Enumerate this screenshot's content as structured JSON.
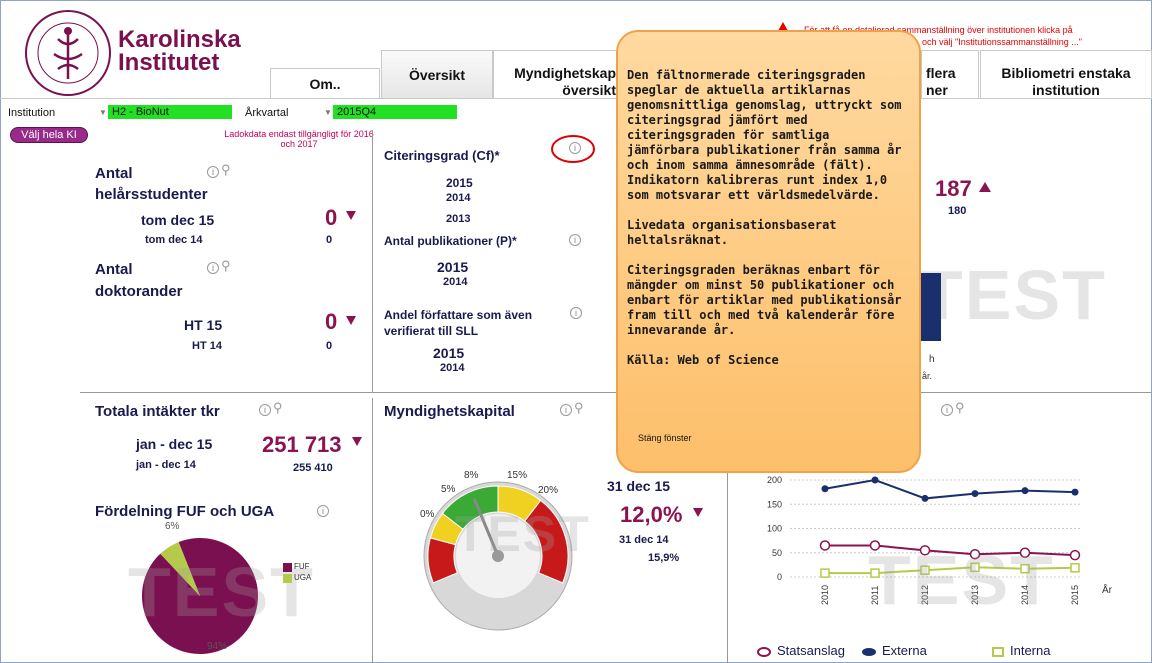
{
  "header": {
    "logo_line1": "Karolinska",
    "logo_line2": "Institutet",
    "notice_line1": "För att få en detaljerad sammanställning över institutionen klicka på",
    "notice_line2": "och välj \"Institutionssammanställning ...\""
  },
  "tabs": [
    {
      "label": "Om.."
    },
    {
      "label": "Översikt"
    },
    {
      "label": "Myndighetskap\növersikt"
    },
    {
      "label": "flera\nner"
    },
    {
      "label": "Bibliometri enstaka\ninstitution"
    }
  ],
  "filters": {
    "institution_label": "Institution",
    "institution_value": "H2 - BioNut",
    "period_label": "Årkvartal",
    "period_value": "2015Q4",
    "select_all_ki": "Välj hela KI",
    "ladok_note": "Ladokdata endast tillgängligt för 2016 och 2017"
  },
  "students": {
    "title_line1": "Antal",
    "title_line2": "helårsstudenter",
    "current_label": "tom dec 15",
    "current_value": "0",
    "prev_label": "tom dec 14",
    "prev_value": "0"
  },
  "phd": {
    "title_line1": "Antal",
    "title_line2": "doktorander",
    "current_label": "HT 15",
    "current_value": "0",
    "prev_label": "HT 14",
    "prev_value": "0"
  },
  "citation": {
    "title": "Citeringsgrad (Cf)*",
    "years": [
      "2015",
      "2014",
      "2013"
    ],
    "pub_title": "Antal publikationer (P)*",
    "pub_years": [
      "2015",
      "2014"
    ],
    "authors_title": "Andel författare som även verifierat till SLL",
    "authors_years": [
      "2015",
      "2014"
    ]
  },
  "hidden_kpi": {
    "value": "187",
    "prev": "180",
    "partial_h": "h",
    "partial_ar": "år."
  },
  "income": {
    "title": "Totala intäkter tkr",
    "current_label": "jan - dec 15",
    "current_value": "251 713",
    "prev_label": "jan - dec 14",
    "prev_value": "255 410",
    "dist_title": "Fördelning FUF och UGA"
  },
  "pie": {
    "chart_data": {
      "type": "pie",
      "categories": [
        "FUF",
        "UGA"
      ],
      "values": [
        94,
        6
      ],
      "labels": [
        "94%",
        "6%"
      ]
    },
    "colors": {
      "FUF": "#7b1050",
      "UGA": "#b5c94a"
    }
  },
  "capital": {
    "title": "Myndighetskapital",
    "gauge_labels": [
      "0%",
      "5%",
      "8%",
      "15%",
      "20%"
    ],
    "current_label": "31 dec 15",
    "current_value": "12,0%",
    "prev_label": "31 dec 14",
    "prev_value": "15,9%",
    "gauge_level_percent": 12.0
  },
  "line_chart": {
    "chart_data": {
      "type": "line",
      "x": [
        "2010",
        "2011",
        "2012",
        "2013",
        "2014",
        "2015"
      ],
      "xlabel": "År",
      "ylim": [
        0,
        200
      ],
      "yticks": [
        "0",
        "50",
        "100",
        "150",
        "200"
      ],
      "series": [
        {
          "name": "Statsanslag",
          "values": [
            65,
            65,
            55,
            47,
            50,
            45
          ]
        },
        {
          "name": "Externa",
          "values": [
            182,
            200,
            162,
            172,
            178,
            175
          ]
        },
        {
          "name": "Interna",
          "values": [
            8,
            8,
            14,
            20,
            17,
            19
          ]
        }
      ]
    },
    "colors": {
      "Statsanslag": "#8b1450",
      "Externa": "#1a2f6e",
      "Interna": "#b5c94a"
    }
  },
  "watermark": "TEST",
  "popup": {
    "text": "Den fältnormerade citeringsgraden speglar de aktuella artiklarnas genomsnittliga genomslag, uttryckt som citeringsgrad jämfört med citeringsgraden för samtliga jämförbara publikationer från samma år och inom samma ämnesområde (fält). Indikatorn kalibreras runt index 1,0 som motsvarar ett världsmedelvärde.\n\nLivedata organisationsbaserat heltalsräknat.\n\nCiteringsgraden beräknas enbart för mängder om minst 50 publikationer och enbart för artiklar med publikationsår fram till och med två kalenderår före innevarande år.\n\nKälla: Web of Science",
    "close_label": "Stäng fönster"
  }
}
